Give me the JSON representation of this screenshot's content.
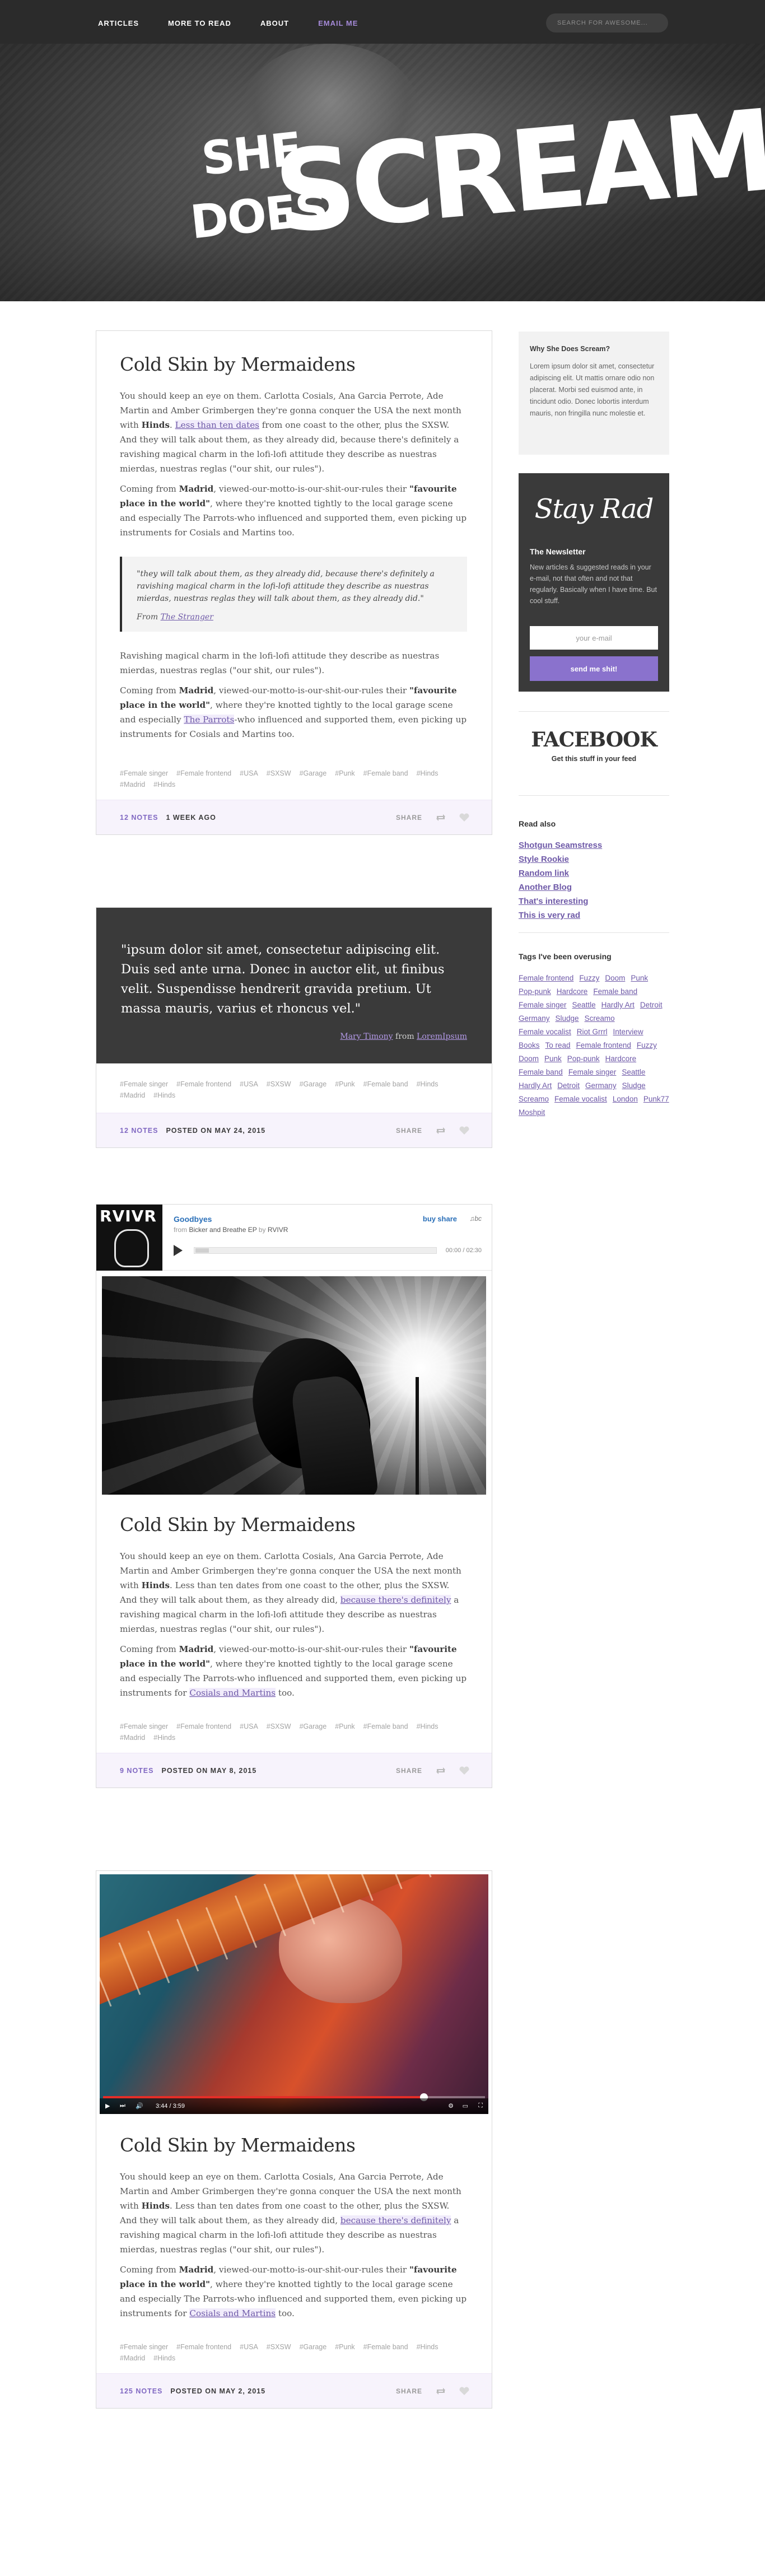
{
  "nav": {
    "links": [
      "ARTICLES",
      "MORE TO READ",
      "ABOUT",
      "EMAIL ME"
    ],
    "search_placeholder": "SEARCH FOR AWESOME..."
  },
  "hero": {
    "logo_she": "SHE",
    "logo_does": "DOES",
    "logo_scream": "SCREAM"
  },
  "posts": [
    {
      "title": "Cold Skin by Mermaidens",
      "p1_a": "You should keep an eye on them. Carlotta Cosials, Ana Garcia Perrote, Ade Martin and Amber Grimbergen they're gonna conquer the USA the next month with ",
      "p1_b": "Hinds",
      "p1_c": ". ",
      "p1_link": "Less than ten dates",
      "p1_d": " from one coast to the other, plus the SXSW. And they will talk about them, as they already did, because there's definitely a ravishing magical charm in the lofi-lofi attitude they describe as nuestras mierdas, nuestras reglas (\"our shit, our rules\").",
      "p2_a": "Coming from ",
      "p2_b": "Madrid",
      "p2_c": ", viewed-our-motto-is-our-shit-our-rules their ",
      "p2_d": "\"favourite place in the world\"",
      "p2_e": ", where they're knotted tightly to the local garage scene and especially The Parrots-who influenced and supported them, even picking up instruments for Cosials and Martins too.",
      "quote": "\"they will talk about them, as they already did, because there's definitely a ravishing magical charm in the lofi-lofi attitude they describe as nuestras mierdas, nuestras reglas they will talk about them, as they already did.\"",
      "quote_from": "From",
      "quote_src": "The Stranger",
      "p3": "Ravishing magical charm in the lofi-lofi attitude they describe as nuestras mierdas, nuestras reglas (\"our shit, our rules\").",
      "p4_a": "Coming from ",
      "p4_b": "Madrid",
      "p4_c": ", viewed-our-motto-is-our-shit-our-rules their ",
      "p4_d": "\"favourite place in the world\"",
      "p4_e": ", where they're knotted tightly to the local garage scene and especially ",
      "p4_link": "The Parrots",
      "p4_f": "-who influenced and supported them, even picking up instruments for Cosials and Martins too.",
      "notes": "12 NOTES",
      "when": "1 WEEK AGO"
    },
    {
      "quote": "\"ipsum dolor sit amet, consectetur adipiscing elit. Duis sed ante urna. Donec in auctor elit, ut finibus velit. Suspendisse hendrerit gravida pretium. Ut massa mauris, varius et rhoncus vel.\"",
      "author": "Mary Timony",
      "from": "from",
      "source": "LoremIpsum",
      "notes": "12 NOTES",
      "when": "POSTED ON MAY 24, 2015"
    },
    {
      "player": {
        "art_label": "RVIVR",
        "title": "Goodbyes",
        "from_prefix": "from",
        "album": "Bicker and Breathe EP",
        "by": "by",
        "artist": "RVIVR",
        "buy": "buy",
        "share": "share",
        "brand": "♫bc",
        "time": "00:00 / 02:30"
      },
      "title": "Cold Skin by Mermaidens",
      "p1_a": "You should keep an eye on them. Carlotta Cosials, Ana Garcia Perrote, Ade Martin and Amber Grimbergen they're gonna conquer the USA the next month with ",
      "p1_b": "Hinds",
      "p1_c": ". Less than ten dates from one coast to the other, plus the SXSW. And they will talk about them, as they already did, ",
      "p1_link": "because there's definitely",
      "p1_d": " a ravishing magical charm in the lofi-lofi attitude they describe as nuestras mierdas, nuestras reglas (\"our shit, our rules\").",
      "p2_a": "Coming from ",
      "p2_b": "Madrid",
      "p2_c": ", viewed-our-motto-is-our-shit-our-rules their ",
      "p2_d": "\"favourite place in the world\"",
      "p2_e": ", where they're knotted tightly to the local garage scene and especially The Parrots-who influenced and supported them, even picking up instruments for ",
      "p2_link": "Cosials and Martins",
      "p2_f": " too.",
      "notes": "9 NOTES",
      "when": "POSTED ON MAY 8, 2015"
    },
    {
      "video_time": "3:44 / 3:59",
      "title": "Cold Skin by Mermaidens",
      "p1_a": "You should keep an eye on them. Carlotta Cosials, Ana Garcia Perrote, Ade Martin and Amber Grimbergen they're gonna conquer the USA the next month with ",
      "p1_b": "Hinds",
      "p1_c": ". Less than ten dates from one coast to the other, plus the SXSW. And they will talk about them, as they already did, ",
      "p1_link": "because there's definitely",
      "p1_d": " a ravishing magical charm in the lofi-lofi attitude they describe as nuestras mierdas, nuestras reglas (\"our shit, our rules\").",
      "p2_a": "Coming from ",
      "p2_b": "Madrid",
      "p2_c": ", viewed-our-motto-is-our-shit-our-rules their ",
      "p2_d": "\"favourite place in the world\"",
      "p2_e": ", where they're knotted tightly to the local garage scene and especially The Parrots-who influenced and supported them, even picking up instruments for ",
      "p2_link": "Cosials and Martins",
      "p2_f": " too.",
      "notes": "125 NOTES",
      "when": "POSTED ON MAY 2, 2015"
    }
  ],
  "tags": [
    "#Female singer",
    "#Female frontend",
    "#USA",
    "#SXSW",
    "#Garage",
    "#Punk",
    "#Female band",
    "#Hinds",
    "#Madrid",
    "#Hinds"
  ],
  "share_label": "SHARE",
  "sidebar": {
    "why_title": "Why She Does Scream?",
    "why_text": "Lorem ipsum dolor sit amet, consectetur adipiscing elit. Ut mattis ornare odio non placerat. Morbi sed euismod ante, in tincidunt odio. Donec lobortis interdum mauris, non fringilla nunc molestie et.",
    "stay_rad": "Stay Rad",
    "news_title": "The Newsletter",
    "news_desc": "New articles & suggested reads in your e-mail, not that often and not that regularly. Basically when I have time. But cool stuff.",
    "email_placeholder": "your e-mail",
    "send_label": "send me shit!",
    "fb_logo": "FACEBOOK",
    "fb_sub": "Get this stuff in your feed",
    "read_title": "Read also",
    "read_links": [
      "Shotgun Seamstress",
      "Style Rookie",
      "Random link",
      "Another Blog",
      "That's interesting",
      "This is very rad"
    ],
    "tags_title": "Tags I've been overusing",
    "tags": [
      "Female frontend",
      "Fuzzy",
      "Doom",
      "Punk",
      "Pop-punk",
      "Hardcore",
      "Female band",
      "Female singer",
      "Seattle",
      "Hardly Art",
      "Detroit",
      "Germany",
      "Sludge",
      "Screamo",
      "Female vocalist",
      "Riot Grrrl",
      "Interview",
      "Books",
      "To read",
      "Female frontend",
      "Fuzzy",
      "Doom",
      "Punk",
      "Pop-punk",
      "Hardcore",
      "Female band",
      "Female singer",
      "Seattle",
      "Hardly Art",
      "Detroit",
      "Germany",
      "Sludge",
      "Screamo",
      "Female vocalist",
      "London",
      "Punk77",
      "Moshpit"
    ]
  },
  "colors": {
    "accent": "#8a72cd",
    "link": "#6f5aa8",
    "nav_bg": "#2b2b2b",
    "dark_card": "#3a3a3a"
  }
}
